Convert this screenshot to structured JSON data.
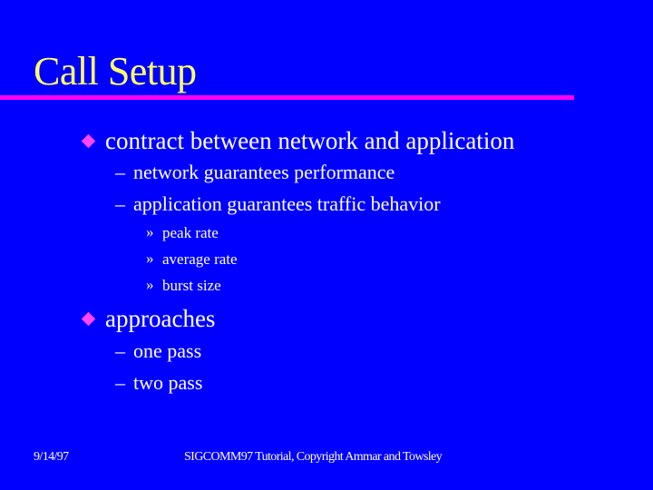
{
  "slide": {
    "title": "Call Setup",
    "accent_colors": {
      "background": "#0000ff",
      "title": "#ffff66",
      "rule": "#ff00ff",
      "bullet": "#ff44ff",
      "text": "#ffffff"
    },
    "bullets": [
      {
        "icon": "diamond-bullet-icon",
        "text": "contract between network and application",
        "sub": [
          {
            "marker": "–",
            "text": "network guarantees performance",
            "sub": []
          },
          {
            "marker": "–",
            "text": "application guarantees traffic behavior",
            "sub": [
              {
                "marker": "»",
                "text": "peak rate"
              },
              {
                "marker": "»",
                "text": "average rate"
              },
              {
                "marker": "»",
                "text": "burst size"
              }
            ]
          }
        ]
      },
      {
        "icon": "diamond-bullet-icon",
        "text": "approaches",
        "sub": [
          {
            "marker": "–",
            "text": "one pass",
            "sub": []
          },
          {
            "marker": "–",
            "text": "two pass",
            "sub": []
          }
        ]
      }
    ]
  },
  "footer": {
    "date": "9/14/97",
    "center": "SIGCOMM97 Tutorial, Copyright Ammar and Towsley"
  }
}
